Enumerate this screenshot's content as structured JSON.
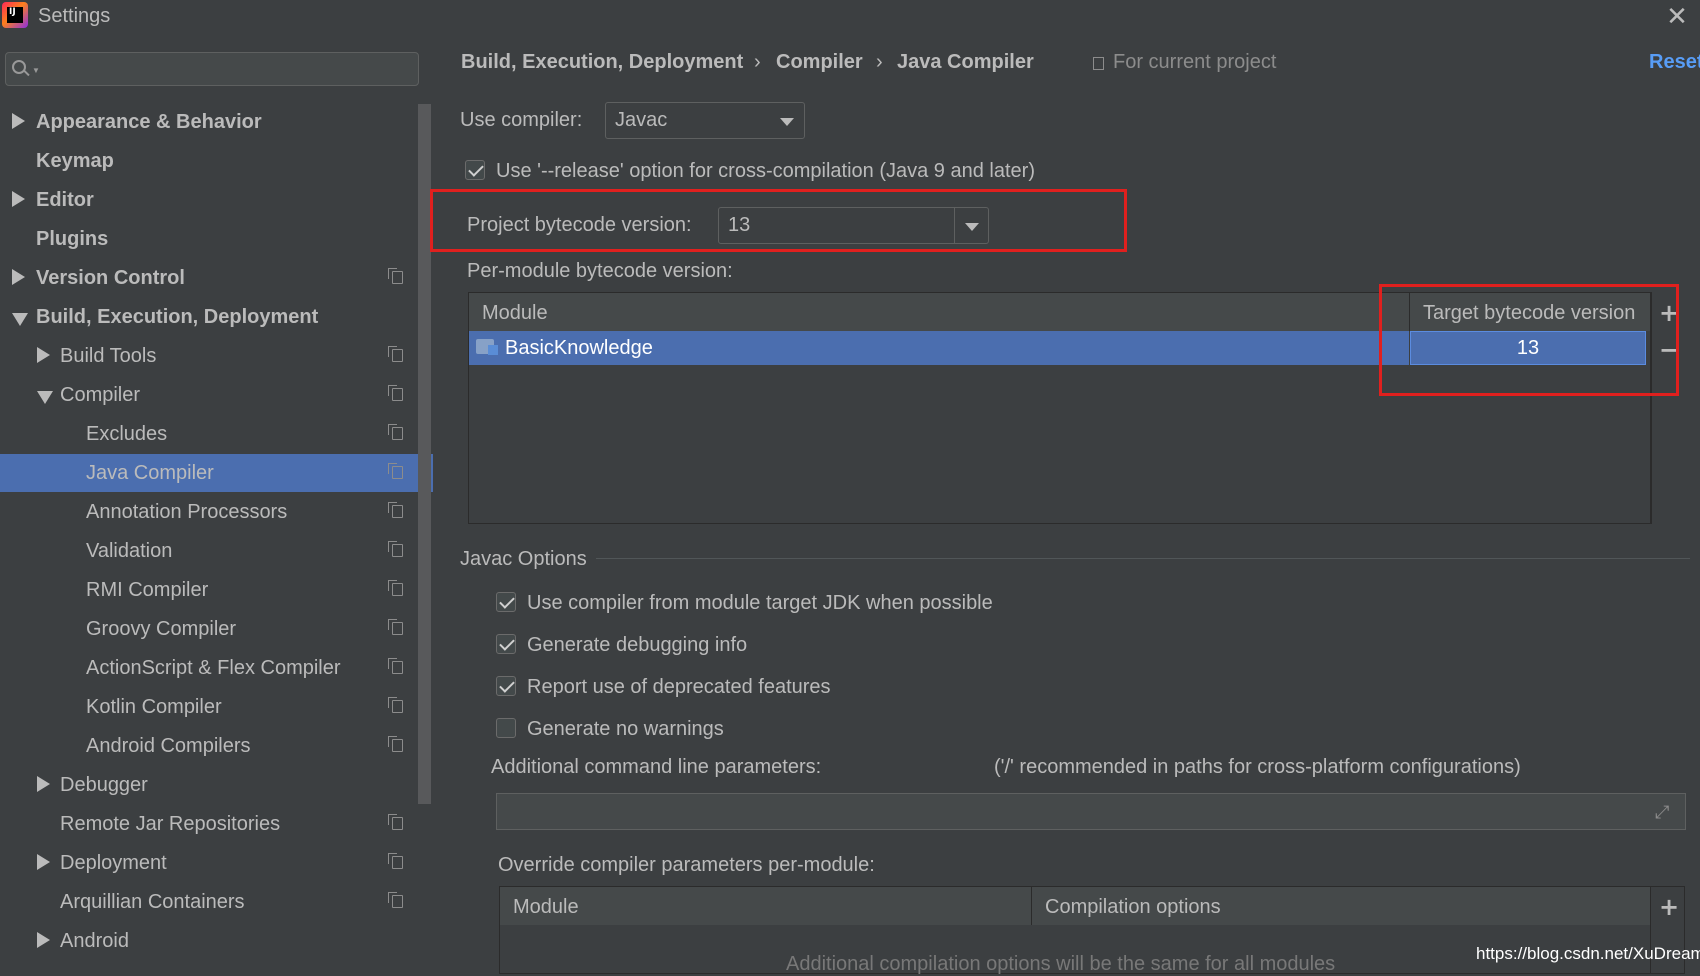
{
  "window": {
    "title": "Settings",
    "logo_text": "IJ"
  },
  "sidebar": {
    "search_placeholder": "",
    "items": [
      {
        "label": "Appearance & Behavior",
        "bold": true,
        "arrow": "right",
        "level": 0,
        "project": false
      },
      {
        "label": "Keymap",
        "bold": true,
        "arrow": "none",
        "level": 0,
        "project": false
      },
      {
        "label": "Editor",
        "bold": true,
        "arrow": "right",
        "level": 0,
        "project": false
      },
      {
        "label": "Plugins",
        "bold": true,
        "arrow": "none",
        "level": 0,
        "project": false
      },
      {
        "label": "Version Control",
        "bold": true,
        "arrow": "right",
        "level": 0,
        "project": true
      },
      {
        "label": "Build, Execution, Deployment",
        "bold": true,
        "arrow": "down",
        "level": 0,
        "project": false
      },
      {
        "label": "Build Tools",
        "bold": false,
        "arrow": "right",
        "level": 1,
        "project": true
      },
      {
        "label": "Compiler",
        "bold": false,
        "arrow": "down",
        "level": 1,
        "project": true
      },
      {
        "label": "Excludes",
        "bold": false,
        "arrow": "none",
        "level": 2,
        "project": true
      },
      {
        "label": "Java Compiler",
        "bold": false,
        "arrow": "none",
        "level": 2,
        "project": true,
        "selected": true
      },
      {
        "label": "Annotation Processors",
        "bold": false,
        "arrow": "none",
        "level": 2,
        "project": true
      },
      {
        "label": "Validation",
        "bold": false,
        "arrow": "none",
        "level": 2,
        "project": true
      },
      {
        "label": "RMI Compiler",
        "bold": false,
        "arrow": "none",
        "level": 2,
        "project": true
      },
      {
        "label": "Groovy Compiler",
        "bold": false,
        "arrow": "none",
        "level": 2,
        "project": true
      },
      {
        "label": "ActionScript & Flex Compiler",
        "bold": false,
        "arrow": "none",
        "level": 2,
        "project": true
      },
      {
        "label": "Kotlin Compiler",
        "bold": false,
        "arrow": "none",
        "level": 2,
        "project": true
      },
      {
        "label": "Android Compilers",
        "bold": false,
        "arrow": "none",
        "level": 2,
        "project": true
      },
      {
        "label": "Debugger",
        "bold": false,
        "arrow": "right",
        "level": 1,
        "project": false
      },
      {
        "label": "Remote Jar Repositories",
        "bold": false,
        "arrow": "none",
        "level": 1,
        "project": true
      },
      {
        "label": "Deployment",
        "bold": false,
        "arrow": "right",
        "level": 1,
        "project": true
      },
      {
        "label": "Arquillian Containers",
        "bold": false,
        "arrow": "none",
        "level": 1,
        "project": true
      },
      {
        "label": "Android",
        "bold": false,
        "arrow": "right",
        "level": 1,
        "project": false
      }
    ]
  },
  "header": {
    "breadcrumb": [
      "Build, Execution, Deployment",
      "Compiler",
      "Java Compiler"
    ],
    "separator": "›",
    "scope": "For current project",
    "reset": "Reset"
  },
  "compiler": {
    "use_compiler_label": "Use compiler:",
    "use_compiler_value": "Javac",
    "release_option_label": "Use '--release' option for cross-compilation (Java 9 and later)",
    "release_option_checked": true,
    "project_bytecode_label": "Project bytecode version:",
    "project_bytecode_value": "13",
    "per_module_label": "Per-module bytecode version:",
    "module_table": {
      "headers": [
        "Module",
        "Target bytecode version"
      ],
      "rows": [
        {
          "module": "BasicKnowledge",
          "target": "13"
        }
      ],
      "add": "+",
      "remove": "−"
    }
  },
  "javac": {
    "section_title": "Javac Options",
    "options": [
      {
        "label": "Use compiler from module target JDK when possible",
        "checked": true
      },
      {
        "label": "Generate debugging info",
        "checked": true
      },
      {
        "label": "Report use of deprecated features",
        "checked": true
      },
      {
        "label": "Generate no warnings",
        "checked": false
      }
    ],
    "cmd_label": "Additional command line parameters:",
    "cmd_hint": "('/' recommended in paths for cross-platform configurations)",
    "cmd_value": "",
    "override_label": "Override compiler parameters per-module:",
    "override_headers": [
      "Module",
      "Compilation options"
    ],
    "override_empty": "Additional compilation options will be the same for all modules",
    "override_add": "+"
  },
  "watermark": "https://blog.csdn.net/XuDream",
  "colors": {
    "background": "#3c3f41",
    "selection": "#4b6eaf",
    "link": "#589df6",
    "highlight_box": "#e0201e"
  }
}
